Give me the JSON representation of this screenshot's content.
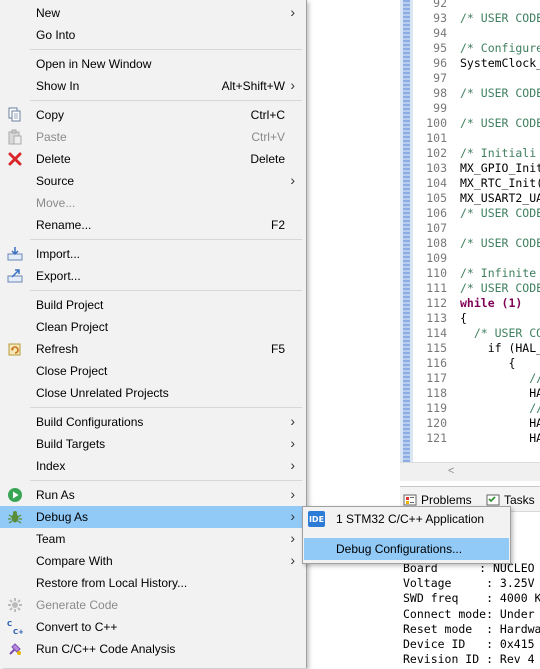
{
  "colors": {
    "accent_selection": "#91c9f7",
    "menu_bg": "#f2f2f2",
    "comment_green": "#3f7f5f",
    "keyword_purple": "#7f0055"
  },
  "context_menu": {
    "items": [
      {
        "label": "New",
        "accel": "",
        "submenu": true,
        "icon": ""
      },
      {
        "label": "Go Into",
        "accel": "",
        "submenu": false,
        "icon": ""
      },
      {
        "label": "Open in New Window",
        "accel": "",
        "submenu": false,
        "icon": ""
      },
      {
        "label": "Show In",
        "accel": "Alt+Shift+W",
        "submenu": true,
        "icon": ""
      },
      {
        "label": "Copy",
        "accel": "Ctrl+C",
        "submenu": false,
        "icon": "copy-icon"
      },
      {
        "label": "Paste",
        "accel": "Ctrl+V",
        "submenu": false,
        "icon": "paste-icon",
        "disabled": true
      },
      {
        "label": "Delete",
        "accel": "Delete",
        "submenu": false,
        "icon": "delete-icon"
      },
      {
        "label": "Source",
        "accel": "",
        "submenu": true,
        "icon": ""
      },
      {
        "label": "Move...",
        "accel": "",
        "submenu": false,
        "icon": "",
        "disabled": true
      },
      {
        "label": "Rename...",
        "accel": "F2",
        "submenu": false,
        "icon": ""
      },
      {
        "label": "Import...",
        "accel": "",
        "submenu": false,
        "icon": "import-icon"
      },
      {
        "label": "Export...",
        "accel": "",
        "submenu": false,
        "icon": "export-icon"
      },
      {
        "label": "Build Project",
        "accel": "",
        "submenu": false,
        "icon": ""
      },
      {
        "label": "Clean Project",
        "accel": "",
        "submenu": false,
        "icon": ""
      },
      {
        "label": "Refresh",
        "accel": "F5",
        "submenu": false,
        "icon": "refresh-icon"
      },
      {
        "label": "Close Project",
        "accel": "",
        "submenu": false,
        "icon": ""
      },
      {
        "label": "Close Unrelated Projects",
        "accel": "",
        "submenu": false,
        "icon": ""
      },
      {
        "label": "Build Configurations",
        "accel": "",
        "submenu": true,
        "icon": ""
      },
      {
        "label": "Build Targets",
        "accel": "",
        "submenu": true,
        "icon": ""
      },
      {
        "label": "Index",
        "accel": "",
        "submenu": true,
        "icon": ""
      },
      {
        "label": "Run As",
        "accel": "",
        "submenu": true,
        "icon": "run-icon"
      },
      {
        "label": "Debug As",
        "accel": "",
        "submenu": true,
        "icon": "debug-icon",
        "selected": true
      },
      {
        "label": "Team",
        "accel": "",
        "submenu": true,
        "icon": ""
      },
      {
        "label": "Compare With",
        "accel": "",
        "submenu": true,
        "icon": ""
      },
      {
        "label": "Restore from Local History...",
        "accel": "",
        "submenu": false,
        "icon": ""
      },
      {
        "label": "Generate Code",
        "accel": "",
        "submenu": false,
        "icon": "generate-code-icon",
        "disabled": true
      },
      {
        "label": "Convert to C++",
        "accel": "",
        "submenu": false,
        "icon": "convert-cpp-icon"
      },
      {
        "label": "Run C/C++ Code Analysis",
        "accel": "",
        "submenu": false,
        "icon": "code-analysis-icon"
      }
    ]
  },
  "submenu": {
    "items": [
      {
        "label": "1 STM32 C/C++ Application",
        "badge": "IDE"
      },
      {
        "label": "Debug Configurations...",
        "selected": true
      }
    ]
  },
  "editor": {
    "lines": [
      {
        "num": "92",
        "text": "",
        "cls": "plain"
      },
      {
        "num": "93",
        "text": "/* USER CODE",
        "cls": "cm"
      },
      {
        "num": "94",
        "text": "",
        "cls": "plain"
      },
      {
        "num": "95",
        "text": "/* Configure",
        "cls": "cm"
      },
      {
        "num": "96",
        "text": "SystemClock_",
        "cls": "plain"
      },
      {
        "num": "97",
        "text": "",
        "cls": "plain"
      },
      {
        "num": "98",
        "text": "/* USER CODE",
        "cls": "cm"
      },
      {
        "num": "99",
        "text": "",
        "cls": "plain"
      },
      {
        "num": "100",
        "text": "/* USER CODE",
        "cls": "cm"
      },
      {
        "num": "101",
        "text": "",
        "cls": "plain"
      },
      {
        "num": "102",
        "text": "/* Initiali",
        "cls": "cm"
      },
      {
        "num": "103",
        "text": "MX_GPIO_Init",
        "cls": "plain"
      },
      {
        "num": "104",
        "text": "MX_RTC_Init(",
        "cls": "plain"
      },
      {
        "num": "105",
        "text": "MX_USART2_UA",
        "cls": "plain"
      },
      {
        "num": "106",
        "text": "/* USER CODE",
        "cls": "cm"
      },
      {
        "num": "107",
        "text": "",
        "cls": "plain"
      },
      {
        "num": "108",
        "text": "/* USER CODE",
        "cls": "cm"
      },
      {
        "num": "109",
        "text": "",
        "cls": "plain"
      },
      {
        "num": "110",
        "text": "/* Infinite",
        "cls": "cm"
      },
      {
        "num": "111",
        "text": "/* USER CODE",
        "cls": "cm"
      },
      {
        "num": "112",
        "text": "while (1)",
        "cls": "kw"
      },
      {
        "num": "113",
        "text": "{",
        "cls": "plain"
      },
      {
        "num": "114",
        "text": "  /* USER CO",
        "cls": "cm"
      },
      {
        "num": "115",
        "text": "    if (HAL_",
        "cls": "plain"
      },
      {
        "num": "116",
        "text": "       {",
        "cls": "plain"
      },
      {
        "num": "117",
        "text": "          //",
        "cls": "cm"
      },
      {
        "num": "118",
        "text": "          HA",
        "cls": "plain"
      },
      {
        "num": "119",
        "text": "          //",
        "cls": "cm"
      },
      {
        "num": "120",
        "text": "          HA",
        "cls": "plain"
      },
      {
        "num": "121",
        "text": "          HA",
        "cls": "plain"
      }
    ]
  },
  "views": {
    "tabs": [
      {
        "label": "Problems",
        "icon": "problems-icon"
      },
      {
        "label": "Tasks",
        "icon": "tasks-icon"
      }
    ],
    "console_lines": [
      "Board      : NUCLEO",
      "Voltage     : 3.25V",
      "SWD freq    : 4000 K",
      "Connect mode: Under",
      "Reset mode  : Hardwa",
      "Device ID   : 0x415",
      "Revision ID : Rev 4"
    ]
  }
}
